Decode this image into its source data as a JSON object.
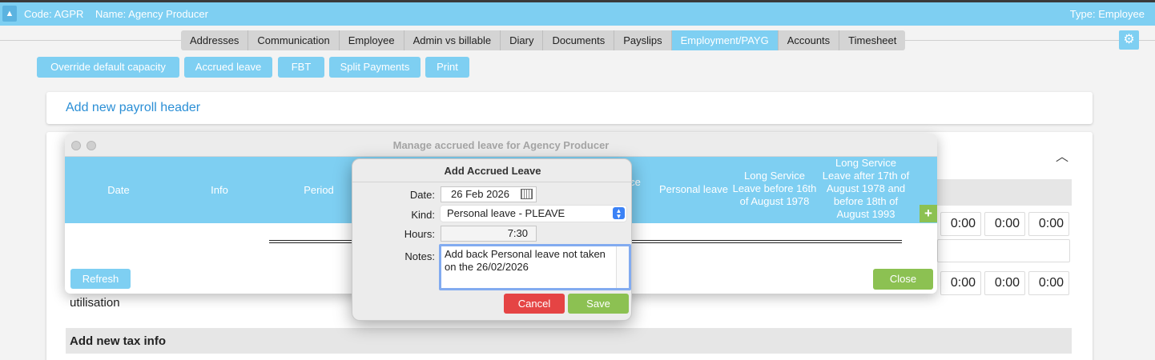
{
  "header": {
    "code": "Code: AGPR",
    "name": "Name: Agency Producer",
    "type": "Type: Employee"
  },
  "tabs": [
    {
      "label": "Addresses",
      "active": false
    },
    {
      "label": "Communication",
      "active": false
    },
    {
      "label": "Employee",
      "active": false
    },
    {
      "label": "Admin vs billable",
      "active": false
    },
    {
      "label": "Diary",
      "active": false
    },
    {
      "label": "Documents",
      "active": false
    },
    {
      "label": "Payslips",
      "active": false
    },
    {
      "label": "Employment/PAYG",
      "active": true
    },
    {
      "label": "Accounts",
      "active": false
    },
    {
      "label": "Timesheet",
      "active": false
    }
  ],
  "actions": {
    "override": "Override default capacity",
    "accrued": "Accrued leave",
    "fbt": "FBT",
    "split": "Split Payments",
    "print": "Print"
  },
  "payroll": {
    "add_header": "Add new payroll header"
  },
  "background": {
    "hours_row1": [
      "0:00",
      "0:00",
      "0:00"
    ],
    "hours_row2": [
      "0:00",
      "0:00",
      "0:00"
    ],
    "utilisation": "utilisation",
    "add_tax": "Add new tax info"
  },
  "leave_window": {
    "title": "Manage accrued leave for Agency Producer",
    "columns": {
      "date": "Date",
      "info": "Info",
      "period": "Period",
      "partial": "ce",
      "personal": "Personal leave",
      "ls_before": "Long Service Leave before 16th of August 1978",
      "ls_after": "Long Service Leave after 17th of August 1978 and before 18th of August 1993"
    },
    "add": "+",
    "refresh": "Refresh",
    "close": "Close"
  },
  "dialog": {
    "title": "Add Accrued Leave",
    "date_label": "Date:",
    "date_value": "26 Feb 2026",
    "kind_label": "Kind:",
    "kind_value": "Personal leave - PLEAVE",
    "hours_label": "Hours:",
    "hours_value": "7:30",
    "notes_label": "Notes:",
    "notes_value": "Add back Personal leave not taken on the 26/02/2026",
    "cancel": "Cancel",
    "save": "Save"
  }
}
